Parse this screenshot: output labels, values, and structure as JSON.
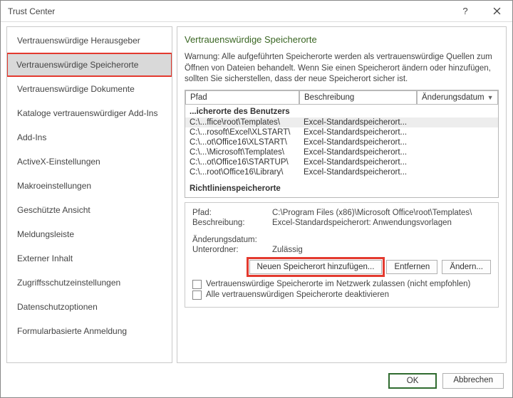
{
  "window": {
    "title": "Trust Center"
  },
  "sidebar": {
    "items": [
      {
        "label": "Vertrauenswürdige Herausgeber"
      },
      {
        "label": "Vertrauenswürdige Speicherorte"
      },
      {
        "label": "Vertrauenswürdige Dokumente"
      },
      {
        "label": "Kataloge vertrauenswürdiger Add-Ins"
      },
      {
        "label": "Add-Ins"
      },
      {
        "label": "ActiveX-Einstellungen"
      },
      {
        "label": "Makroeinstellungen"
      },
      {
        "label": "Geschützte Ansicht"
      },
      {
        "label": "Meldungsleiste"
      },
      {
        "label": "Externer Inhalt"
      },
      {
        "label": "Zugriffsschutzeinstellungen"
      },
      {
        "label": "Datenschutzoptionen"
      },
      {
        "label": "Formularbasierte Anmeldung"
      }
    ],
    "selected_index": 1
  },
  "panel": {
    "heading": "Vertrauenswürdige Speicherorte",
    "text": "Warnung: Alle aufgeführten Speicherorte werden als vertrauenswürdige Quellen zum Öffnen von Dateien behandelt. Wenn Sie einen Speicherort ändern oder hinzufügen, sollten Sie sicherstellen, dass der neue Speicherort sicher ist.",
    "columns": {
      "path": "Pfad",
      "desc": "Beschreibung",
      "date": "Änderungsdatum"
    },
    "col_widths": {
      "path": "160px",
      "desc": "165px",
      "date": "auto"
    },
    "group_user": "...icherorte des Benutzers",
    "group_policy": "Richtlinienspeicherorte",
    "rows": [
      {
        "path": "C:\\...ffice\\root\\Templates\\",
        "desc": "Excel-Standardspeicherort..."
      },
      {
        "path": "C:\\...rosoft\\Excel\\XLSTART\\",
        "desc": "Excel-Standardspeicherort..."
      },
      {
        "path": "C:\\...ot\\Office16\\XLSTART\\",
        "desc": "Excel-Standardspeicherort..."
      },
      {
        "path": "C:\\...\\Microsoft\\Templates\\",
        "desc": "Excel-Standardspeicherort..."
      },
      {
        "path": "C:\\...ot\\Office16\\STARTUP\\",
        "desc": "Excel-Standardspeicherort..."
      },
      {
        "path": "C:\\...root\\Office16\\Library\\",
        "desc": "Excel-Standardspeicherort..."
      }
    ],
    "selected_row": 0,
    "details": {
      "path_label": "Pfad:",
      "path_value": "C:\\Program Files (x86)\\Microsoft Office\\root\\Templates\\",
      "desc_label": "Beschreibung:",
      "desc_value": "Excel-Standardspeicherort: Anwendungsvorlagen",
      "date_label": "Änderungsdatum:",
      "date_value": "",
      "sub_label": "Unterordner:",
      "sub_value": "Zulässig"
    },
    "buttons": {
      "add": "Neuen Speicherort hinzufügen...",
      "remove": "Entfernen",
      "modify": "Ändern..."
    },
    "checks": {
      "network": "Vertrauenswürdige Speicherorte im Netzwerk zulassen (nicht empfohlen)",
      "disable_all": "Alle vertrauenswürdigen Speicherorte deaktivieren"
    }
  },
  "footer": {
    "ok": "OK",
    "cancel": "Abbrechen"
  }
}
